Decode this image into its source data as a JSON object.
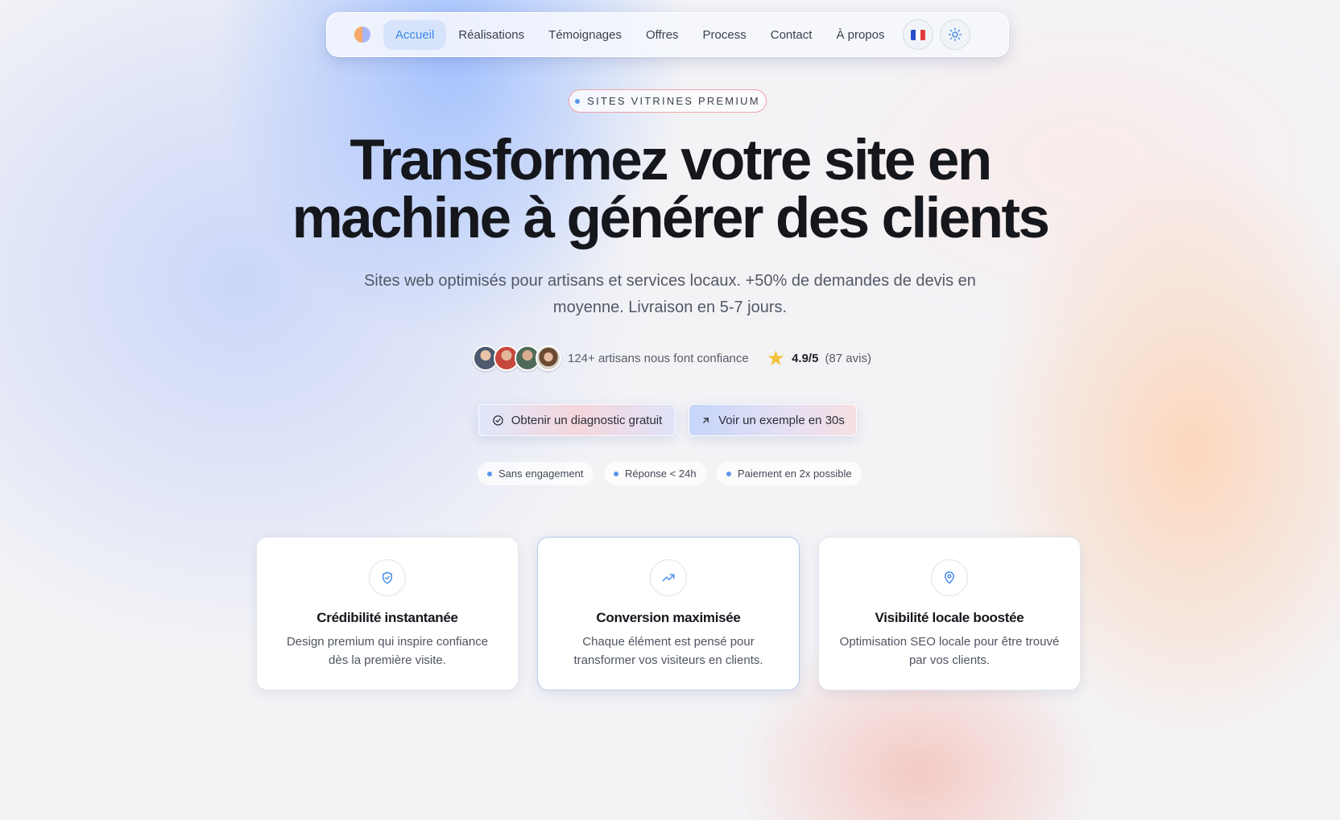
{
  "nav": {
    "items": [
      {
        "label": "Accueil",
        "active": true
      },
      {
        "label": "Réalisations",
        "active": false
      },
      {
        "label": "Témoignages",
        "active": false
      },
      {
        "label": "Offres",
        "active": false
      },
      {
        "label": "Process",
        "active": false
      },
      {
        "label": "Contact",
        "active": false
      },
      {
        "label": "À propos",
        "active": false
      }
    ],
    "language_icon": "france-flag-icon",
    "theme_icon": "sun-icon"
  },
  "hero": {
    "badge": "SITES VITRINES PREMIUM",
    "headline_line1": "Transformez votre site en",
    "headline_line2": "machine à générer des clients",
    "subtitle": "Sites web optimisés pour artisans et services locaux. +50% de demandes de devis en moyenne. Livraison en 5-7 jours.",
    "trust_text": "124+ artisans nous font confiance",
    "rating": "4.9/5",
    "reviews": "(87 avis)",
    "cta_primary": "Obtenir un diagnostic gratuit",
    "cta_secondary": "Voir un exemple en 30s",
    "pills": [
      "Sans engagement",
      "Réponse < 24h",
      "Paiement en 2x possible"
    ]
  },
  "features": [
    {
      "icon": "shield-check-icon",
      "title": "Crédibilité instantanée",
      "description": "Design premium qui inspire confiance dès la première visite."
    },
    {
      "icon": "trending-up-icon",
      "title": "Conversion maximisée",
      "description": "Chaque élément est pensé pour transformer vos visiteurs en clients."
    },
    {
      "icon": "map-pin-icon",
      "title": "Visibilité locale boostée",
      "description": "Optimisation SEO locale pour être trouvé par vos clients."
    }
  ],
  "colors": {
    "accent": "#3d8ae8",
    "heading": "#15171c",
    "body_text": "#535866",
    "star": "#f5c23b"
  }
}
